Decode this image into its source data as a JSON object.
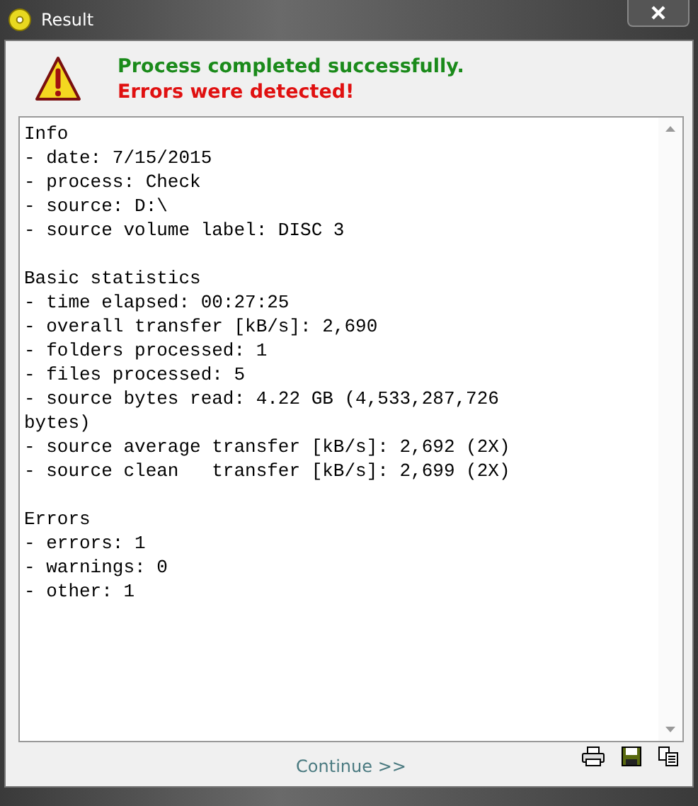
{
  "window": {
    "title": "Result"
  },
  "status": {
    "success": "Process completed successfully.",
    "error": "Errors were detected!"
  },
  "report": {
    "sections": [
      {
        "heading": "Info",
        "lines": [
          "- date: 7/15/2015",
          "- process: Check",
          "- source: D:\\",
          "- source volume label: DISC 3"
        ]
      },
      {
        "heading": "Basic statistics",
        "lines": [
          "- time elapsed: 00:27:25",
          "- overall transfer [kB/s]: 2,690",
          "- folders processed: 1",
          "- files processed: 5",
          "- source bytes read: 4.22 GB (4,533,287,726",
          "bytes)",
          "- source average transfer [kB/s]: 2,692 (2X)",
          "- source clean   transfer [kB/s]: 2,699 (2X)"
        ]
      },
      {
        "heading": "Errors",
        "lines": [
          "- errors: 1",
          "- warnings: 0",
          "- other: 1"
        ]
      }
    ]
  },
  "footer": {
    "continue": "Continue >>"
  }
}
